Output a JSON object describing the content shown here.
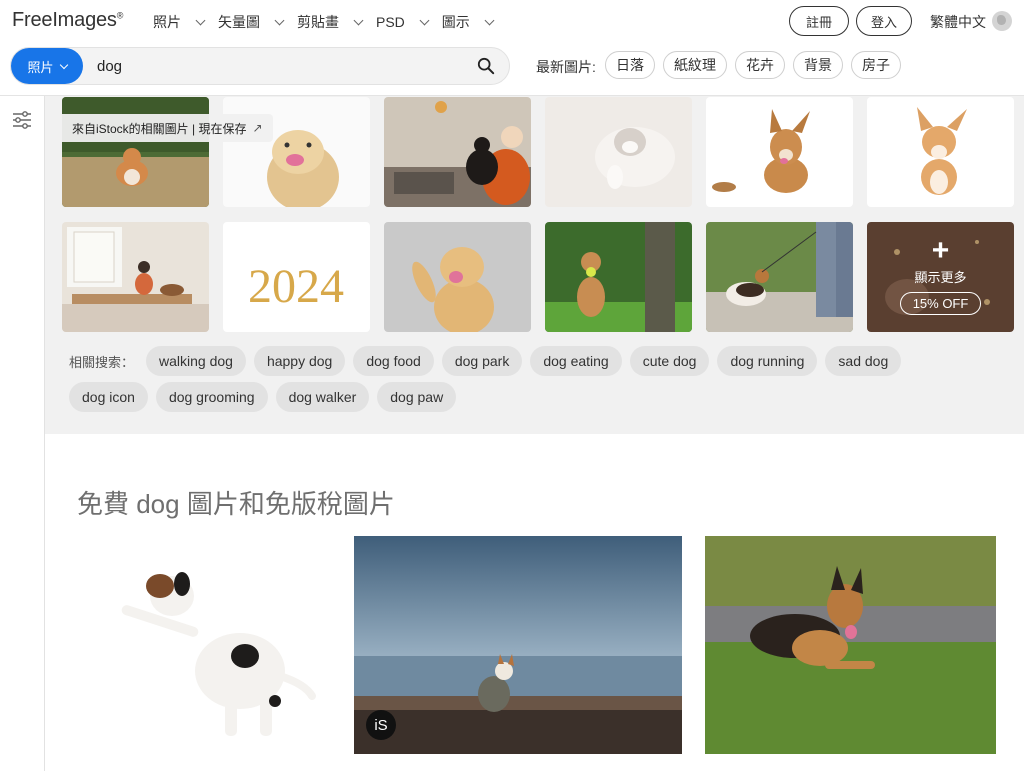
{
  "header": {
    "logo": "FreeImages",
    "logo_mark": "®",
    "nav": [
      {
        "label": "照片"
      },
      {
        "label": "矢量圖"
      },
      {
        "label": "剪貼畫"
      },
      {
        "label": "PSD"
      },
      {
        "label": "圖示"
      }
    ],
    "register": "註冊",
    "login": "登入",
    "language": "繁體中文"
  },
  "search": {
    "type_label": "照片",
    "query": "dog",
    "icon": "search-icon"
  },
  "latest": {
    "label": "最新圖片:",
    "tags": [
      "日落",
      "紙紋理",
      "花卉",
      "背景",
      "房子"
    ]
  },
  "sponsored": {
    "banner": "來自iStock的相關圖片 | 現在保存",
    "banner_arrow": "↗",
    "more": {
      "plus": "+",
      "label": "顯示更多",
      "discount": "15% OFF"
    },
    "thumb_2024_text": "2024"
  },
  "related": {
    "label": "相關搜索：",
    "row1": [
      "walking dog",
      "happy dog",
      "dog food",
      "dog park",
      "dog eating",
      "cute dog",
      "dog running",
      "sad dog"
    ],
    "row2": [
      "dog icon",
      "dog grooming",
      "dog walker",
      "dog paw"
    ]
  },
  "free": {
    "title": "免費 dog 圖片和免版稅圖片",
    "badge": "iS"
  },
  "colors": {
    "accent": "#1875e8"
  }
}
